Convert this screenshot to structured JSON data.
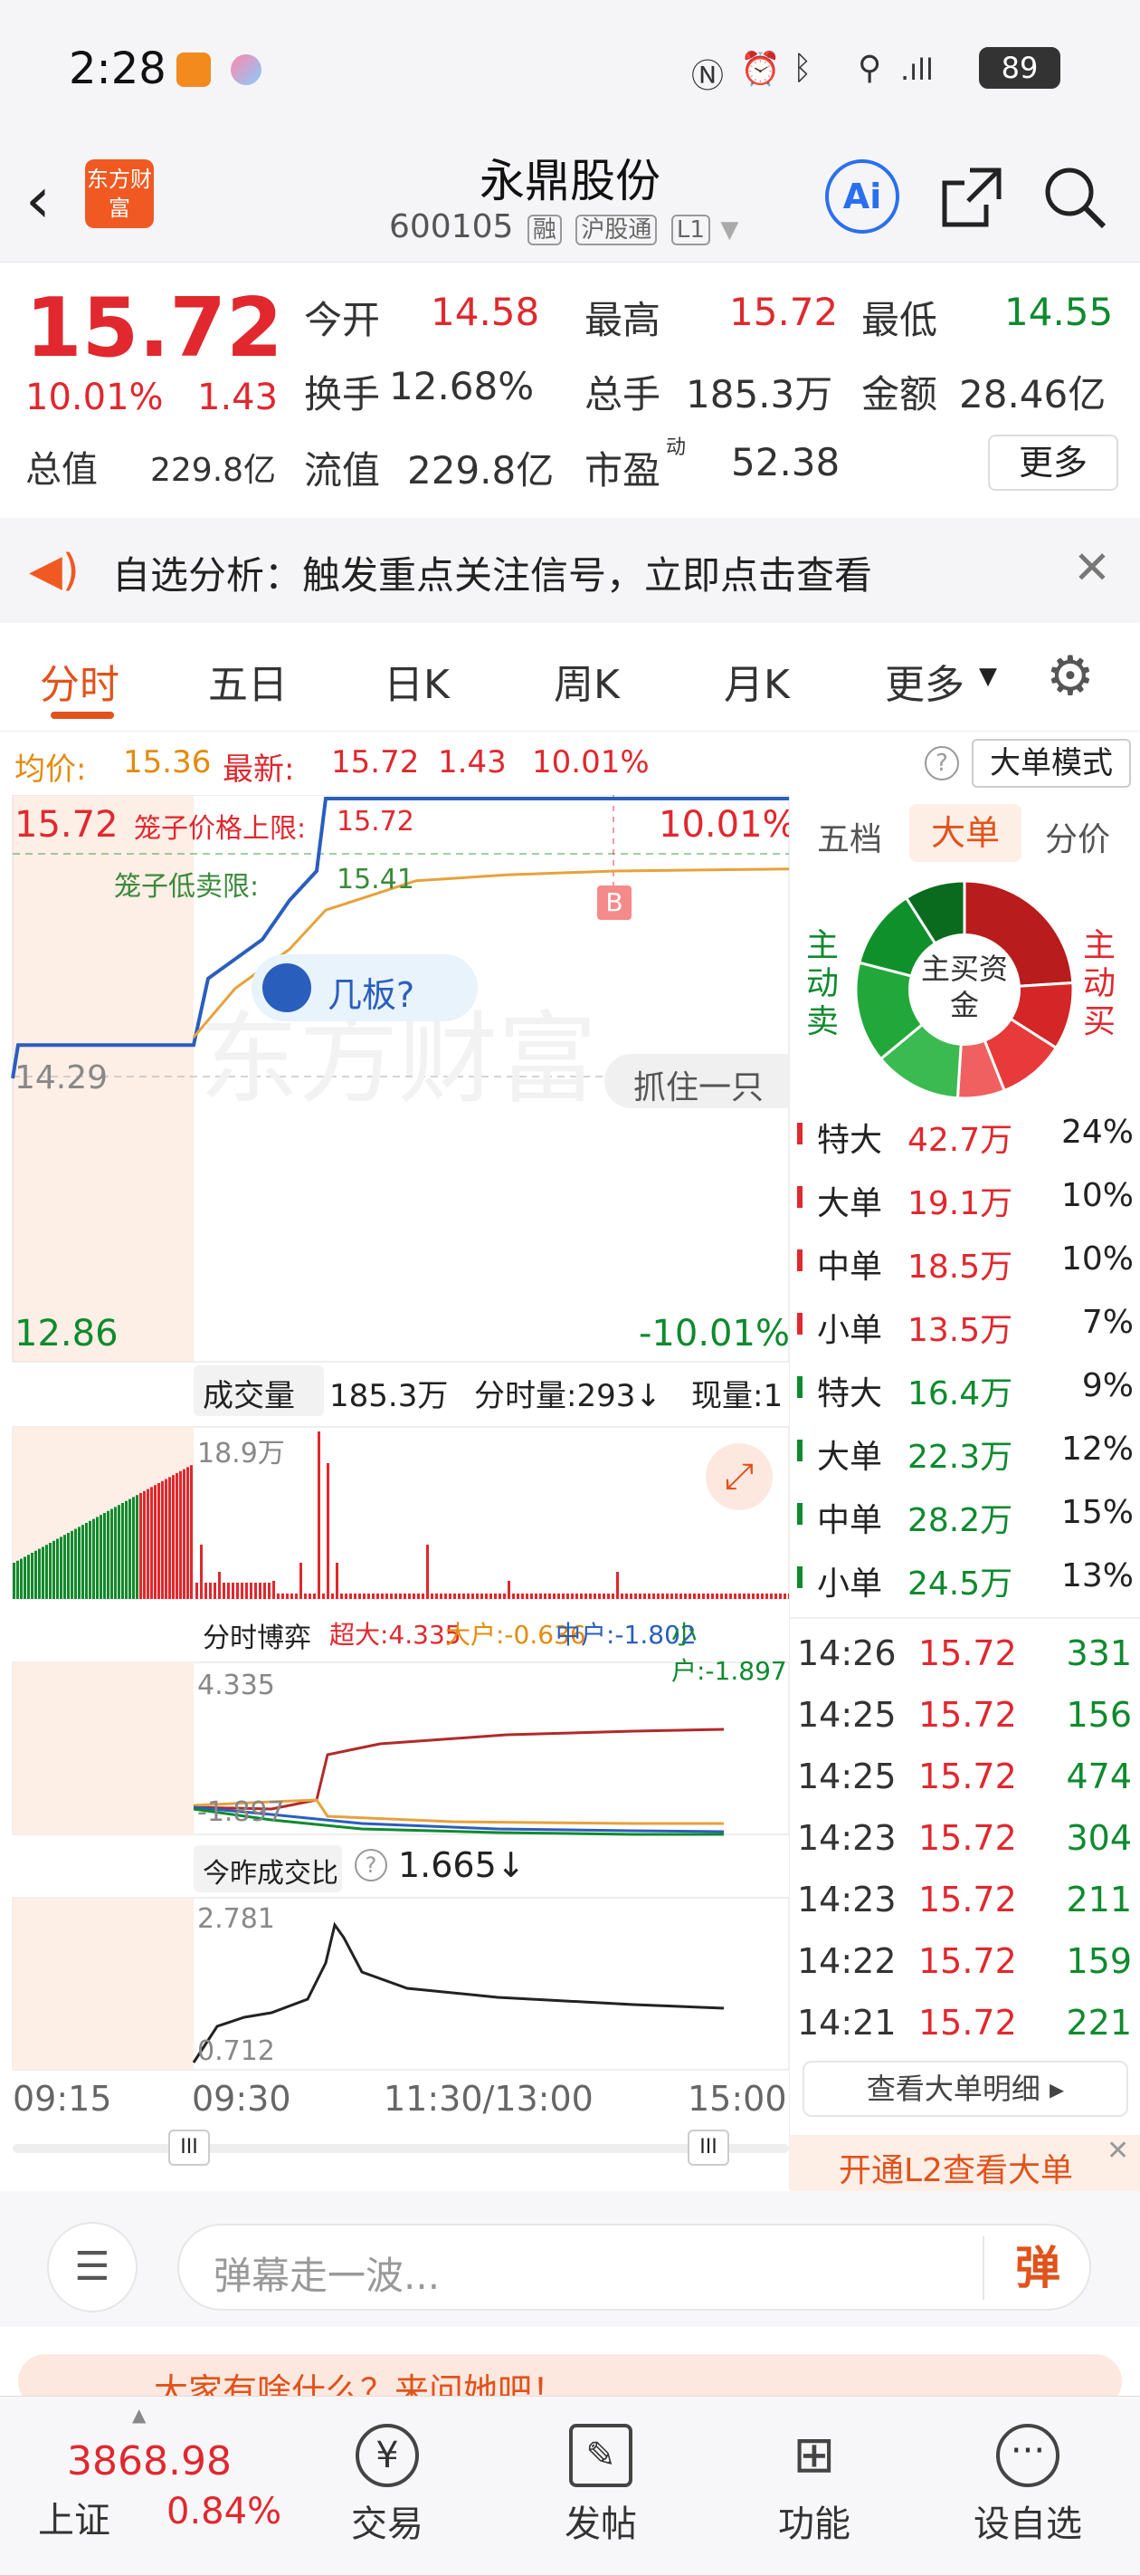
{
  "status_bar": {
    "time": "2:28",
    "battery": "89"
  },
  "header": {
    "title": "永鼎股份",
    "code": "600105",
    "tags": [
      "融",
      "沪股通",
      "L1"
    ],
    "logo_text": "东方财富",
    "ai_label": "Ai"
  },
  "quote": {
    "price": "15.72",
    "change_pct": "10.01%",
    "change": "1.43",
    "fields": [
      {
        "label": "今开",
        "value": "14.58"
      },
      {
        "label": "最高",
        "value": "15.72"
      },
      {
        "label": "最低",
        "value": "14.55"
      },
      {
        "label": "换手",
        "value": "12.68%"
      },
      {
        "label": "总手",
        "value": "185.3万"
      },
      {
        "label": "金额",
        "value": "28.46亿"
      },
      {
        "label": "总值",
        "value": "229.8亿"
      },
      {
        "label": "流值",
        "value": "229.8亿"
      },
      {
        "label": "市盈",
        "sup": "动",
        "value": "52.38"
      }
    ],
    "more": "更多"
  },
  "notice": {
    "text": "自选分析：触发重点关注信号，立即点击查看"
  },
  "tabs": [
    "分时",
    "五日",
    "日K",
    "周K",
    "月K",
    "更多"
  ],
  "infoline": {
    "avg_label": "均价:",
    "avg": "15.36",
    "latest_label": "最新:",
    "latest": "15.72",
    "change": "1.43",
    "pct": "10.01%",
    "mode": "大单模式"
  },
  "chart": {
    "top_left": "15.72",
    "top_right": "10.01%",
    "cage_label": "笼子价格上限:",
    "cage_value": "15.72",
    "cage_buy": "笼子低卖限:",
    "cage_buy_value": "15.41",
    "mid": "14.29",
    "bottom_left": "12.86",
    "bottom_right": "-10.01%",
    "bubble": "几板?",
    "watermark": "东方财富",
    "grab": "抓住一只",
    "b_marker": "B",
    "vol_label": "成交量",
    "vol_total": "185.3万",
    "vol_minute": "分时量:293↓",
    "vol_now": "现量:1",
    "vol_max": "18.9万",
    "game_label": "分时博弈",
    "game_super": "超大:4.335",
    "game_big": "大户:-0.636",
    "game_mid": "中户:-1.802",
    "game_small": "小户:-1.897",
    "game_top": "4.335",
    "game_bottom": "-1.897",
    "ratio_label": "今昨成交比",
    "ratio_value": "1.665↓",
    "ratio_top": "2.781",
    "ratio_bottom": "0.712",
    "times": [
      "09:15",
      "09:30",
      "11:30/13:00",
      "15:00"
    ]
  },
  "chart_data": [
    {
      "type": "line",
      "title": "",
      "series": [
        {
          "name": "",
          "x": [
            "09:15",
            "09:30",
            "11:30/13:00",
            "15:00"
          ],
          "y": [
            14.29,
            14.58,
            15.72,
            15.72
          ]
        }
      ],
      "ylim": [
        12.86,
        15.72
      ]
    }
  ],
  "right": {
    "tabs": [
      "五档",
      "大单",
      "分价"
    ],
    "donut_center": "主买资金",
    "buy_side": "主动买",
    "sell_side": "主动卖",
    "flows": [
      {
        "label": "特大",
        "amount": "42.7万",
        "pct": "24%",
        "side": "buy"
      },
      {
        "label": "大单",
        "amount": "19.1万",
        "pct": "10%",
        "side": "buy"
      },
      {
        "label": "中单",
        "amount": "18.5万",
        "pct": "10%",
        "side": "buy"
      },
      {
        "label": "小单",
        "amount": "13.5万",
        "pct": "7%",
        "side": "buy"
      },
      {
        "label": "特大",
        "amount": "16.4万",
        "pct": "9%",
        "side": "sell"
      },
      {
        "label": "大单",
        "amount": "22.3万",
        "pct": "12%",
        "side": "sell"
      },
      {
        "label": "中单",
        "amount": "28.2万",
        "pct": "15%",
        "side": "sell"
      },
      {
        "label": "小单",
        "amount": "24.5万",
        "pct": "13%",
        "side": "sell"
      }
    ],
    "trades": [
      {
        "time": "14:26",
        "price": "15.72",
        "vol": "331"
      },
      {
        "time": "14:25",
        "price": "15.72",
        "vol": "156"
      },
      {
        "time": "14:25",
        "price": "15.72",
        "vol": "474"
      },
      {
        "time": "14:23",
        "price": "15.72",
        "vol": "304"
      },
      {
        "time": "14:23",
        "price": "15.72",
        "vol": "211"
      },
      {
        "time": "14:22",
        "price": "15.72",
        "vol": "159"
      },
      {
        "time": "14:21",
        "price": "15.72",
        "vol": "221"
      }
    ],
    "detail_btn": "查看大单明细 ▸",
    "l2_btn": "开通L2查看大单"
  },
  "danmu": {
    "placeholder": "弹幕走一波...",
    "send": "弹"
  },
  "promo": {
    "text": "大家有啥什么？来问她吧！"
  },
  "bottom": {
    "index_value": "3868.98",
    "index_name": "上证",
    "index_pct": "0.84%",
    "nav": [
      "交易",
      "发帖",
      "功能",
      "设自选"
    ]
  }
}
